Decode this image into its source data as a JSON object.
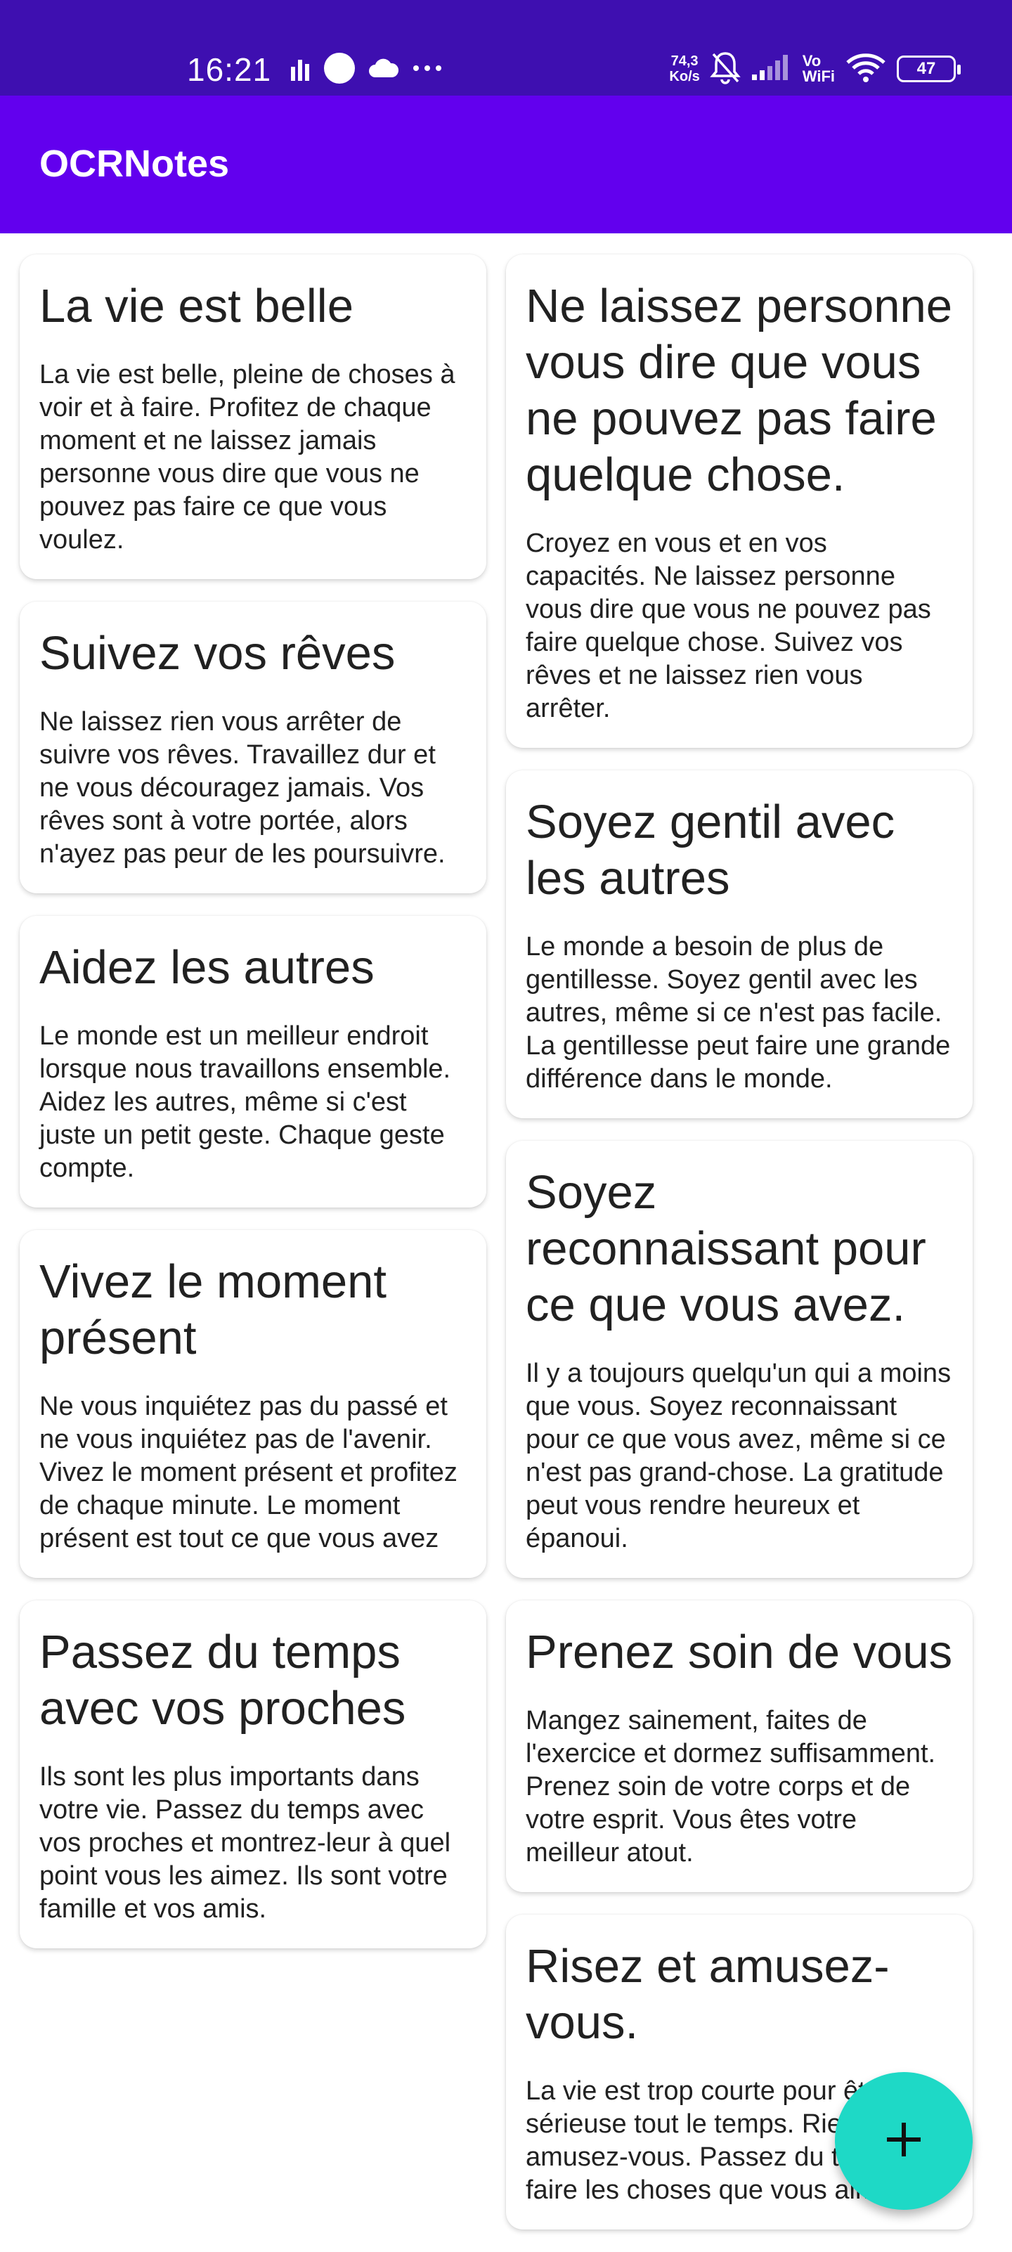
{
  "status_bar": {
    "time": "16:21",
    "net_speed_value": "74,3",
    "net_speed_unit": "Ko/s",
    "vowifi_top": "Vo",
    "vowifi_bottom": "WiFi",
    "battery": "47",
    "background": "#3e0fb0"
  },
  "app_bar": {
    "title": "OCRNotes",
    "background": "#6200ee"
  },
  "notes_left": [
    {
      "title": "La vie est belle",
      "body": "La vie est belle, pleine de choses à voir et à faire. Profitez de chaque moment et ne laissez jamais personne vous dire que vous ne pouvez pas faire ce que vous voulez."
    },
    {
      "title": "Suivez vos rêves",
      "body": "Ne laissez rien vous arrêter de suivre vos rêves. Travaillez dur et ne vous découragez jamais. Vos rêves sont à votre portée, alors n'ayez pas peur de les poursuivre."
    },
    {
      "title": "Aidez les autres",
      "body": "Le monde est un meilleur endroit lorsque nous travaillons ensemble. Aidez les autres, même si c'est juste un petit geste. Chaque geste compte."
    },
    {
      "title": "Vivez le moment présent",
      "body": "Ne vous inquiétez pas du passé et ne vous inquiétez pas de l'avenir. Vivez le moment présent et profitez de chaque minute. Le moment présent est tout ce que vous avez"
    },
    {
      "title": "Passez du temps avec vos proches",
      "body": "Ils sont les plus importants dans votre vie. Passez du temps avec vos proches et montrez-leur à quel point vous les aimez. Ils sont votre famille et vos amis."
    }
  ],
  "notes_right": [
    {
      "title": "Ne laissez personne vous dire que vous ne pouvez pas faire quelque chose.",
      "body": "Croyez en vous et en vos capacités. Ne laissez personne vous dire que vous ne pouvez pas faire quelque chose. Suivez vos rêves et ne laissez rien vous arrêter."
    },
    {
      "title": "Soyez gentil avec les autres",
      "body": "Le monde a besoin de plus de gentillesse. Soyez gentil avec les autres, même si ce n'est pas facile. La gentillesse peut faire une grande différence dans le monde."
    },
    {
      "title": "Soyez reconnaissant pour ce que vous avez.",
      "body": "Il y a toujours quelqu'un qui a moins que vous. Soyez reconnaissant pour ce que vous avez, même si ce n'est pas grand-chose. La gratitude peut vous rendre heureux et épanoui."
    },
    {
      "title": "Prenez soin de vous",
      "body": "Mangez sainement, faites de l'exercice et dormez suffisamment. Prenez soin de votre corps et de votre esprit. Vous êtes votre meilleur atout."
    },
    {
      "title": "Risez et amusez-vous.",
      "body": "La vie est trop courte pour être sérieuse tout le temps. Riez et amusez-vous. Passez du temps à faire les choses que vous aimez."
    }
  ],
  "fab": {
    "icon": "plus-icon",
    "color": "#1ed9c6"
  }
}
